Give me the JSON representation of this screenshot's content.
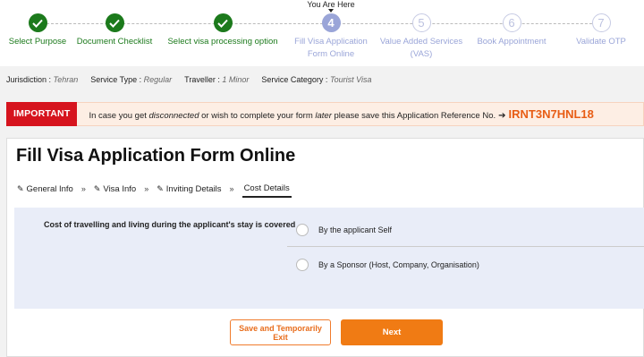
{
  "stepper": {
    "you_are_here": "You Are Here",
    "steps": [
      {
        "number": "1",
        "label": "Select Purpose",
        "status": "done"
      },
      {
        "number": "2",
        "label": "Document Checklist",
        "status": "done"
      },
      {
        "number": "3",
        "label": "Select visa processing option",
        "status": "done"
      },
      {
        "number": "4",
        "label": "Fill Visa Application Form Online",
        "status": "current"
      },
      {
        "number": "5",
        "label": "Value Added Services (VAS)",
        "status": "pending"
      },
      {
        "number": "6",
        "label": "Book Appointment",
        "status": "pending"
      },
      {
        "number": "7",
        "label": "Validate OTP",
        "status": "pending"
      }
    ]
  },
  "info_bar": {
    "jurisdiction_label": "Jurisdiction :",
    "jurisdiction_value": "Tehran",
    "service_type_label": "Service Type :",
    "service_type_value": "Regular",
    "traveller_label": "Traveller :",
    "traveller_value": "1 Minor",
    "service_category_label": "Service Category :",
    "service_category_value": "Tourist Visa"
  },
  "important": {
    "tag": "IMPORTANT",
    "msg_part1": "In case you get ",
    "msg_em1": "disconnected",
    "msg_part2": " or wish to complete your form ",
    "msg_em2": "later",
    "msg_part3": " please save this Application Reference No.",
    "reference": "IRNT3N7HNL18"
  },
  "form": {
    "title": "Fill Visa Application Form Online",
    "tabs": [
      {
        "label": "General Info",
        "icon": "pencil-icon"
      },
      {
        "label": "Visa Info",
        "icon": "pencil-icon"
      },
      {
        "label": "Inviting Details",
        "icon": "pencil-icon"
      },
      {
        "label": "Cost Details",
        "active": true
      }
    ],
    "question": "Cost of travelling and living during the applicant's stay is covered",
    "options": [
      "By the applicant Self",
      "By a Sponsor (Host, Company, Organisation)"
    ],
    "save_label": "Save and Temporarily Exit",
    "next_label": "Next"
  },
  "colors": {
    "done": "#1c7a1c",
    "current": "#9aa5d8",
    "accent": "#f07b14",
    "important_red": "#d6141e",
    "reference_orange": "#e85d15"
  }
}
